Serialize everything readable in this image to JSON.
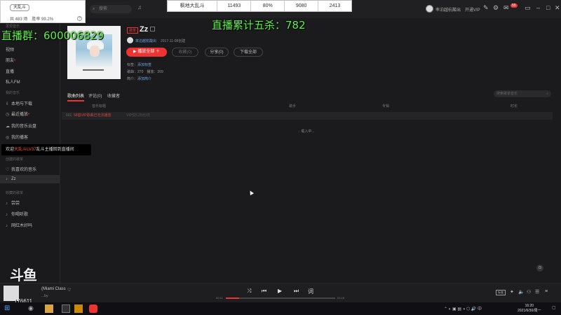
{
  "topbar": {
    "search_placeholder": "搜索",
    "user_name": "率泊越杭酸出",
    "vip_label": "开通VIP",
    "mail_count": "55"
  },
  "stream_overlay": {
    "game_table": [
      "枫地大乱斗",
      "11493",
      "80%",
      "9080",
      "2413"
    ],
    "rank_tag": "大乱斗",
    "rank_line": "共 483 场　胜率 99.2%",
    "group_text": "直播群：600006829",
    "kill_text": "直播累计五杀：782",
    "tooltip_prefix": "欢迎",
    "tooltip_highlight": "大乱斗LV37",
    "tooltip_suffix": "乱斗主播回到直播间",
    "douyu_logo": "斗鱼",
    "room_id": "176611"
  },
  "sidebar": {
    "heading_discover": "发现音乐",
    "items_top": [
      "视频",
      "朋友",
      "直播",
      "私人FM"
    ],
    "heading_mine": "我的音乐",
    "items_mine": [
      "本地与下载",
      "最近播放",
      "我的音乐云盘",
      "我的播客"
    ],
    "heading_created": "创建的歌单",
    "items_created": [
      "我喜欢的音乐",
      "Zz"
    ],
    "heading_collected": "收藏的歌单",
    "items_collected": [
      "尝尝",
      "你喝听歌",
      "网红木好吗"
    ]
  },
  "playlist": {
    "badge": "歌单",
    "title": "Zz",
    "creator": "率泊越杭酸出",
    "date": "2017-11-08创建",
    "play_all": "播放全部",
    "collect": "收藏(0)",
    "share": "分享(0)",
    "download": "下载全部",
    "tags_label": "标签：",
    "tags_value": "添加标签",
    "songs_label": "歌曲：",
    "songs_value": "270",
    "plays_label": "播放：",
    "plays_value": "269",
    "intro_label": "简介：",
    "intro_value": "添加简介"
  },
  "tabs": [
    "歌曲列表",
    "评论(0)",
    "收藏者"
  ],
  "list_search_placeholder": "搜索歌单音乐",
  "columns": [
    "音乐标题",
    "歌手",
    "专辑",
    "时长"
  ],
  "row": {
    "num": "001",
    "name": "58首VIP歌曲已无法播放",
    "vip": "VIP仅5.25元/次"
  },
  "loading_text": "载入中...",
  "player": {
    "song": "(Miami Class",
    "artist": "...by",
    "time_current": "00:11",
    "time_total": "03:16",
    "progress_fraction": 0.12,
    "lyric_label": "标准"
  },
  "taskbar": {
    "time": "16:20",
    "date": "2021/6/30/周一"
  },
  "colors": {
    "accent": "#e33333",
    "overlay_green": "#5ef04a",
    "link": "#6fa2e5"
  }
}
